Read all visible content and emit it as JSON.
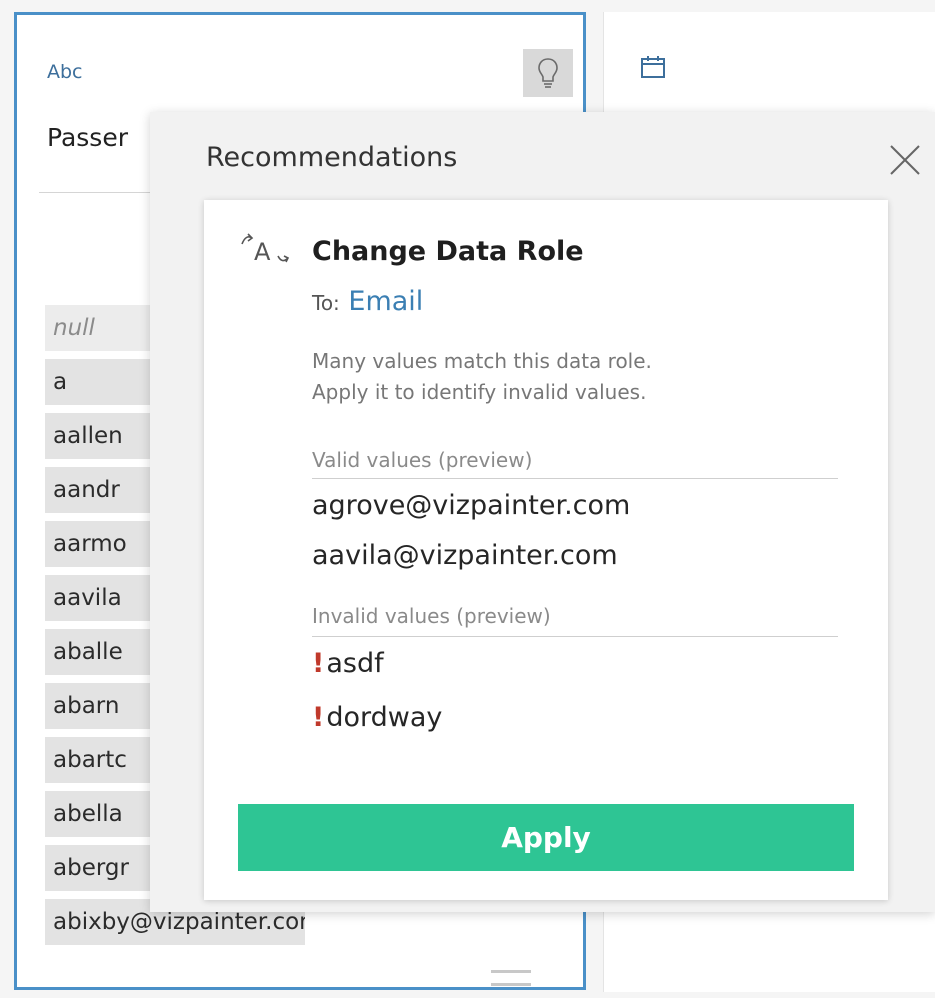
{
  "profile": {
    "type_label": "Abc",
    "field_name": "Passer",
    "values": [
      {
        "text": "null",
        "is_null": true
      },
      {
        "text": "a"
      },
      {
        "text": "aallen"
      },
      {
        "text": "aandr"
      },
      {
        "text": "aarmo"
      },
      {
        "text": "aavila"
      },
      {
        "text": "aballe"
      },
      {
        "text": "abarn"
      },
      {
        "text": "abartc"
      },
      {
        "text": "abella"
      },
      {
        "text": "abergr"
      },
      {
        "text": "abixby@vizpainter.com"
      }
    ]
  },
  "popover": {
    "title": "Recommendations",
    "recommendation": {
      "heading": "Change Data Role",
      "to_label": "To:",
      "to_value": "Email",
      "description_line1": "Many values match this data role.",
      "description_line2": "Apply it to identify invalid values.",
      "valid_label": "Valid values (preview)",
      "valid_values": [
        "agrove@vizpainter.com",
        "aavila@vizpainter.com"
      ],
      "invalid_label": "Invalid values (preview)",
      "invalid_values": [
        "asdf",
        "dordway"
      ],
      "apply_label": "Apply"
    }
  },
  "colors": {
    "accent_border": "#4a90c8",
    "apply_button": "#2ec594",
    "link_blue": "#3b7fb3",
    "invalid_marker": "#c0392b"
  }
}
